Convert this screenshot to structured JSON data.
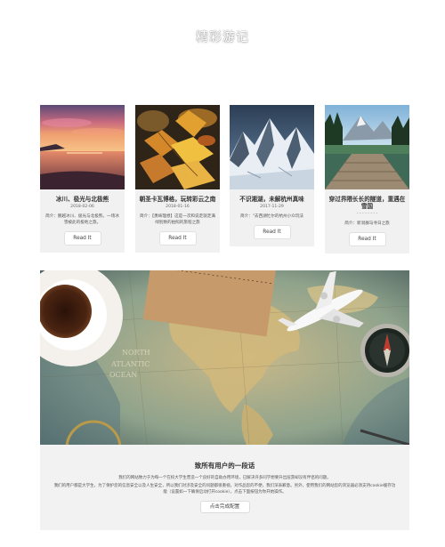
{
  "page": {
    "title": "精彩游记"
  },
  "cards": [
    {
      "image": "sunset-beach-photo",
      "title": "冰川、极光与北极熊",
      "date": "2018-02-06",
      "desc": "简介：鹏越冰川、极光与北极熊。一场冰雪被此的极地之旅。",
      "button": "Read It"
    },
    {
      "image": "autumn-leaves-photo",
      "title": "朝圣卡瓦博格，玩转彩云之南",
      "date": "2018-01-16",
      "desc": "简介：【勇绮理想】这是一次和说走就走满绿别致的拍照的旅程之旅",
      "button": "Read It"
    },
    {
      "image": "snowy-mountain-photo",
      "title": "不识湘湖，未解杭州真味",
      "date": "2017-11-29",
      "desc": "简介：\"去西湖忙尔的杭州小众玩法",
      "button": "Read It"
    },
    {
      "image": "mountain-lake-dock-photo",
      "title": "穿过界隈长长的隧道，重遇在雪国",
      "date": "- - - - - - - -",
      "desc": "简介：新潟群马寻日之旅",
      "button": "Read It"
    }
  ],
  "banner": {
    "image": "travel-map-flatlay-photo"
  },
  "consent": {
    "heading": "致所有用户的一段话",
    "line1": "我们的网站致力于为每一个在校大学生营造一个良好的自助办用环境，已解决许多同学想要升出层游却没有伴侣的问题。",
    "line2": "我们的用户都是大学生，为了保护您的信息安全以及人生安全，所以我们对涉及安全的问题都很重视，对作品您的不便，我们深表歉意。另外，使用我们的网站您的浏览器必须支持cookie缓存功能（设置如一下确保启动打开cookie），点击下面按钮为你开始操作。",
    "button": "点击完成配置"
  },
  "colors": {
    "page_bg": "#ffffff",
    "card_bg": "#f1f1f1",
    "consent_bg": "#f2f2f2"
  }
}
